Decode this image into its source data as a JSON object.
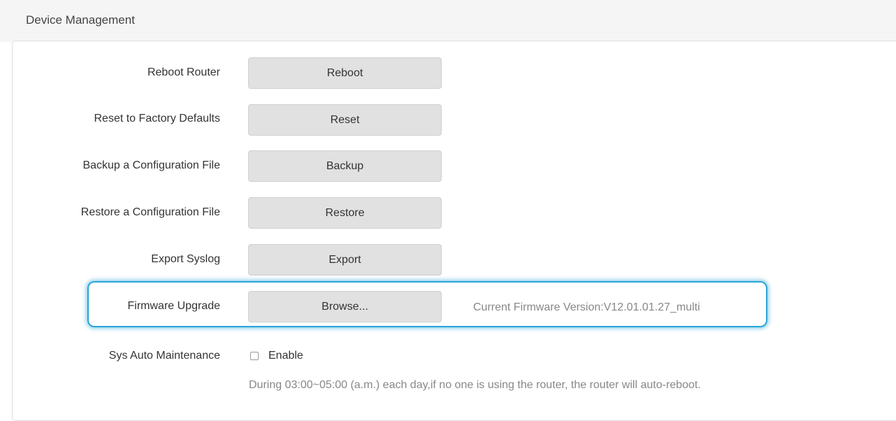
{
  "header": {
    "title": "Device Management"
  },
  "rows": [
    {
      "label": "Reboot Router",
      "button": "Reboot"
    },
    {
      "label": "Reset to Factory Defaults",
      "button": "Reset"
    },
    {
      "label": "Backup a Configuration File",
      "button": "Backup"
    },
    {
      "label": "Restore a Configuration File",
      "button": "Restore"
    },
    {
      "label": "Export Syslog",
      "button": "Export"
    },
    {
      "label": "Firmware Upgrade",
      "button": "Browse..."
    }
  ],
  "firmware": {
    "current_version_text": "Current Firmware Version:V12.01.01.27_multi"
  },
  "auto_maintenance": {
    "label": "Sys Auto Maintenance",
    "checkbox_label": "Enable",
    "checked": false,
    "note": "During 03:00~05:00 (a.m.) each day,if no one is using the router, the router will auto-reboot."
  },
  "colors": {
    "highlight": "#2aa6d8",
    "button_bg": "#e1e1e1",
    "muted_text": "#888888"
  }
}
